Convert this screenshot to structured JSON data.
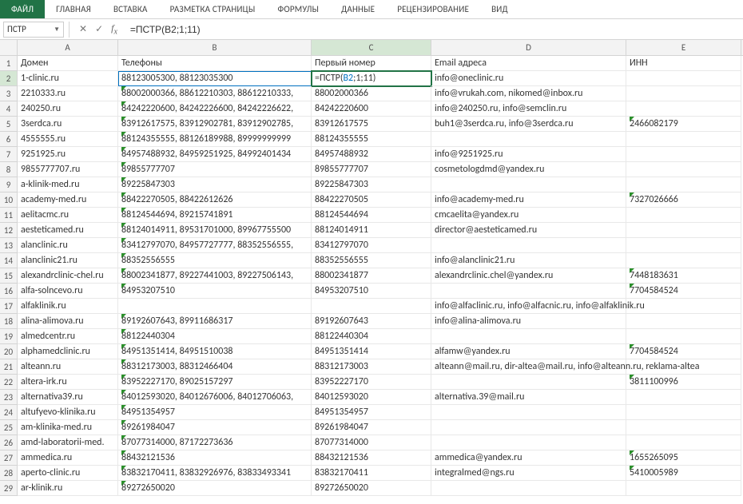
{
  "ribbon": {
    "tabs": [
      "ФАЙЛ",
      "ГЛАВНАЯ",
      "ВСТАВКА",
      "РАЗМЕТКА СТРАНИЦЫ",
      "ФОРМУЛЫ",
      "ДАННЫЕ",
      "РЕЦЕНЗИРОВАНИЕ",
      "ВИД"
    ],
    "active_tab": "ФАЙЛ"
  },
  "name_box": "ПСТР",
  "formula": "=ПСТР(B2;1;11)",
  "edit_cell": {
    "prefix": "=ПСТР(",
    "ref": "B2",
    "suffix": ";1;11)"
  },
  "columns": [
    "A",
    "B",
    "C",
    "D",
    "E"
  ],
  "headers": {
    "A": "Домен",
    "B": "Телефоны",
    "C": "Первый номер",
    "D": "Email адреса",
    "E": "ИНН"
  },
  "rows": [
    {
      "n": 2,
      "A": "1-clinic.ru",
      "B": "88123005300, 88123035300",
      "C": "",
      "D": "info@oneclinic.ru",
      "E": "",
      "tB": false,
      "tE": false
    },
    {
      "n": 3,
      "A": "2210333.ru",
      "B": "88002000366, 88612210303, 88612210333,",
      "C": "88002000366",
      "D": "info@vrukah.com, nikomed@inbox.ru",
      "E": "",
      "tB": true,
      "tE": false
    },
    {
      "n": 4,
      "A": "240250.ru",
      "B": "84242220600, 84242226600, 84242226622,",
      "C": "84242220600",
      "D": "info@240250.ru, info@semclin.ru",
      "E": "",
      "tB": true,
      "tE": false
    },
    {
      "n": 5,
      "A": "3serdca.ru",
      "B": "83912617575, 83912902781, 83912902785,",
      "C": "83912617575",
      "D": "buh1@3serdca.ru, info@3serdca.ru",
      "E": "2466082179",
      "tB": true,
      "tE": true
    },
    {
      "n": 6,
      "A": "4555555.ru",
      "B": "88124355555, 88126189988, 89999999999",
      "C": "88124355555",
      "D": "",
      "E": "",
      "tB": true,
      "tE": false
    },
    {
      "n": 7,
      "A": "9251925.ru",
      "B": "84957488932, 84959251925, 84992401434",
      "C": "84957488932",
      "D": "info@9251925.ru",
      "E": "",
      "tB": true,
      "tE": false
    },
    {
      "n": 8,
      "A": "9855777707.ru",
      "B": "89855777707",
      "C": "89855777707",
      "D": "cosmetologdmd@yandex.ru",
      "E": "",
      "tB": true,
      "tE": false
    },
    {
      "n": 9,
      "A": "a-klinik-med.ru",
      "B": "89225847303",
      "C": "89225847303",
      "D": "",
      "E": "",
      "tB": true,
      "tE": false
    },
    {
      "n": 10,
      "A": "academy-med.ru",
      "B": "88422270505, 88422612626",
      "C": "88422270505",
      "D": "info@academy-med.ru",
      "E": "7327026666",
      "tB": true,
      "tE": true
    },
    {
      "n": 11,
      "A": "aelitacmc.ru",
      "B": "88124544694, 89215741891",
      "C": "88124544694",
      "D": "cmcaelita@yandex.ru",
      "E": "",
      "tB": true,
      "tE": false
    },
    {
      "n": 12,
      "A": "aesteticamed.ru",
      "B": "88124014911, 89531701000, 89967755500",
      "C": "88124014911",
      "D": "director@aesteticamed.ru",
      "E": "",
      "tB": true,
      "tE": false
    },
    {
      "n": 13,
      "A": "alanclinic.ru",
      "B": "83412797070, 84957727777, 88352556555,",
      "C": "83412797070",
      "D": "",
      "E": "",
      "tB": true,
      "tE": false
    },
    {
      "n": 14,
      "A": "alanclinic21.ru",
      "B": "88352556555",
      "C": "88352556555",
      "D": "info@alanclinic21.ru",
      "E": "",
      "tB": true,
      "tE": false
    },
    {
      "n": 15,
      "A": "alexandrclinic-chel.ru",
      "B": "88002341877, 89227441003, 89227506143,",
      "C": "88002341877",
      "D": "alexandrclinic.chel@yandex.ru",
      "E": "7448183631",
      "tB": true,
      "tE": true
    },
    {
      "n": 16,
      "A": "alfa-solncevo.ru",
      "B": "84953207510",
      "C": "84953207510",
      "D": "",
      "E": "7704584524",
      "tB": true,
      "tE": true
    },
    {
      "n": 17,
      "A": "alfaklinik.ru",
      "B": "",
      "C": "",
      "D": "info@alfaclinic.ru, info@alfacnic.ru, info@alfaklinik.ru",
      "E": "",
      "tB": false,
      "tE": false
    },
    {
      "n": 18,
      "A": "alina-alimova.ru",
      "B": "89192607643, 89911686317",
      "C": "89192607643",
      "D": "info@alina-alimova.ru",
      "E": "",
      "tB": true,
      "tE": false
    },
    {
      "n": 19,
      "A": "almedcentr.ru",
      "B": "88122440304",
      "C": "88122440304",
      "D": "",
      "E": "",
      "tB": true,
      "tE": false
    },
    {
      "n": 20,
      "A": "alphamedclinic.ru",
      "B": "84951351414, 84951510038",
      "C": "84951351414",
      "D": "alfamw@yandex.ru",
      "E": "7704584524",
      "tB": true,
      "tE": true
    },
    {
      "n": 21,
      "A": "alteann.ru",
      "B": "88312173003, 88312466404",
      "C": "88312173003",
      "D": "alteann@mail.ru, dir-altea@mail.ru, info@alteann.ru, reklama-altea",
      "E": "",
      "tB": true,
      "tE": false
    },
    {
      "n": 22,
      "A": "altera-irk.ru",
      "B": "83952227170, 89025157297",
      "C": "83952227170",
      "D": "",
      "E": "3811100996",
      "tB": true,
      "tE": true
    },
    {
      "n": 23,
      "A": "alternativa39.ru",
      "B": "84012593020, 84012676006, 84012706063,",
      "C": "84012593020",
      "D": "alternativa.39@mail.ru",
      "E": "",
      "tB": true,
      "tE": false
    },
    {
      "n": 24,
      "A": "altufyevo-klinika.ru",
      "B": "84951354957",
      "C": "84951354957",
      "D": "",
      "E": "",
      "tB": true,
      "tE": false
    },
    {
      "n": 25,
      "A": "am-klinika-med.ru",
      "B": "89261984047",
      "C": "89261984047",
      "D": "",
      "E": "",
      "tB": true,
      "tE": false
    },
    {
      "n": 26,
      "A": "amd-laboratorii-med.",
      "B": "87077314000, 87172273636",
      "C": "87077314000",
      "D": "",
      "E": "",
      "tB": true,
      "tE": false
    },
    {
      "n": 27,
      "A": "ammedica.ru",
      "B": "88432121536",
      "C": "88432121536",
      "D": "ammedica@yandex.ru",
      "E": "1655265095",
      "tB": true,
      "tE": true
    },
    {
      "n": 28,
      "A": "aperto-clinic.ru",
      "B": "83832170411, 83832926976, 83833493341",
      "C": "83832170411",
      "D": "integralmed@ngs.ru",
      "E": "5410005989",
      "tB": true,
      "tE": true
    },
    {
      "n": 29,
      "A": "ar-klinik.ru",
      "B": "89272650020",
      "C": "89272650020",
      "D": "",
      "E": "",
      "tB": true,
      "tE": false
    }
  ]
}
